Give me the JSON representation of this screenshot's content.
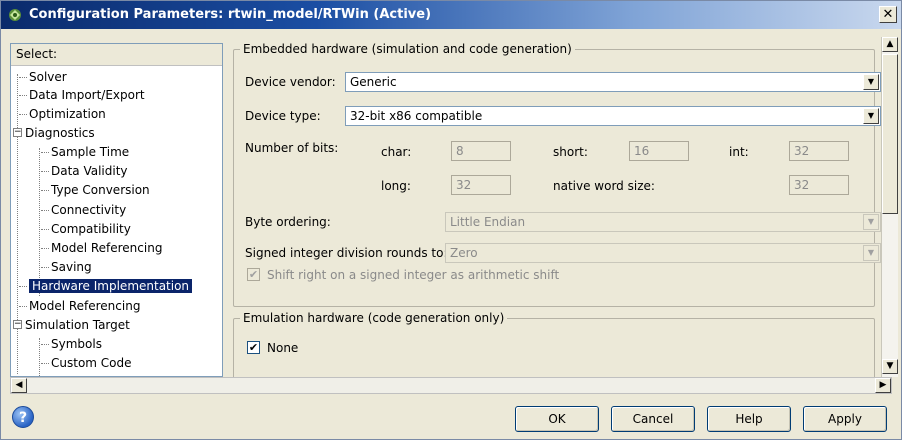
{
  "window": {
    "title": "Configuration Parameters: rtwin_model/RTWin (Active)",
    "close_glyph": "✕"
  },
  "tree": {
    "header": "Select:",
    "items": [
      {
        "label": "Solver"
      },
      {
        "label": "Data Import/Export"
      },
      {
        "label": "Optimization"
      },
      {
        "label": "Diagnostics"
      },
      {
        "label": "Sample Time"
      },
      {
        "label": "Data Validity"
      },
      {
        "label": "Type Conversion"
      },
      {
        "label": "Connectivity"
      },
      {
        "label": "Compatibility"
      },
      {
        "label": "Model Referencing"
      },
      {
        "label": "Saving"
      },
      {
        "label": "Hardware Implementation"
      },
      {
        "label": "Model Referencing"
      },
      {
        "label": "Simulation Target"
      },
      {
        "label": "Symbols"
      },
      {
        "label": "Custom Code"
      }
    ],
    "selected": "Hardware Implementation"
  },
  "embedded": {
    "legend": "Embedded hardware (simulation and code generation)",
    "device_vendor_label": "Device vendor:",
    "device_vendor_value": "Generic",
    "device_type_label": "Device type:",
    "device_type_value": "32-bit x86 compatible",
    "bits_label": "Number of bits:",
    "char_label": "char:",
    "char_value": "8",
    "short_label": "short:",
    "short_value": "16",
    "int_label": "int:",
    "int_value": "32",
    "long_label": "long:",
    "long_value": "32",
    "native_label": "native word size:",
    "native_value": "32",
    "byte_order_label": "Byte ordering:",
    "byte_order_value": "Little Endian",
    "signed_div_label": "Signed integer division rounds to:",
    "signed_div_value": "Zero",
    "shift_label": "Shift right on a signed integer as arithmetic shift",
    "shift_checked": true
  },
  "emulation": {
    "legend": "Emulation hardware (code generation only)",
    "none_label": "None",
    "none_checked": true
  },
  "footer": {
    "help_glyph": "?",
    "ok": "OK",
    "cancel": "Cancel",
    "help": "Help",
    "apply": "Apply"
  },
  "icons": {
    "dropdown": "▼",
    "scroll_up": "▲",
    "scroll_down": "▼",
    "scroll_left": "◀",
    "scroll_right": "▶",
    "check": "✔"
  },
  "colors": {
    "title_bar_start": "#0a2a6b",
    "selection": "#0a246a",
    "dialog_bg": "#ece9d8"
  }
}
